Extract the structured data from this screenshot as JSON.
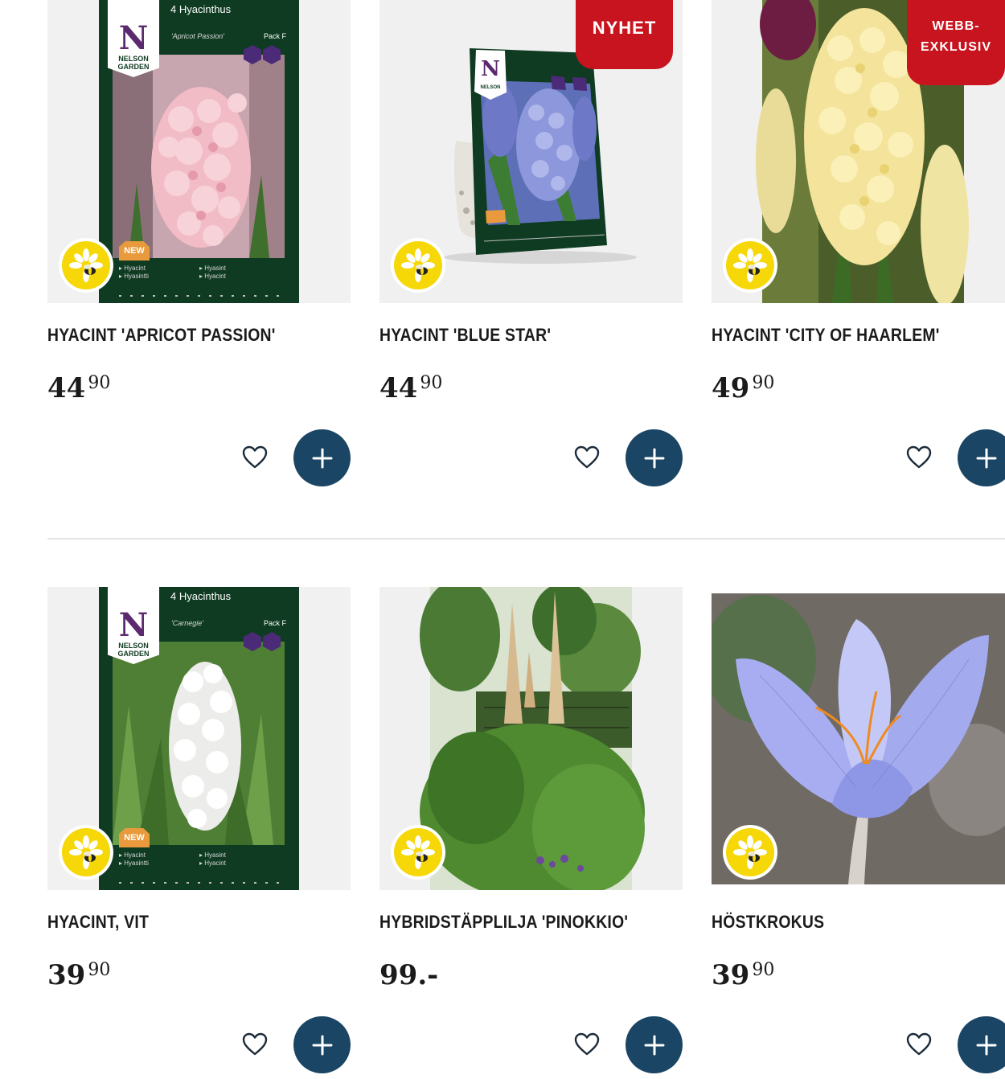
{
  "products": [
    {
      "name": "HYACINT 'APRICOT PASSION'",
      "price_main": "44",
      "price_decimal": "90",
      "image": {
        "kind": "package",
        "package_title": "4 Hyacinthus",
        "package_variety": "'Apricot Passion'",
        "zone_label": "Pack F",
        "new_label": "NEW",
        "lang_left": "Hyacint\nHyasintti",
        "lang_right": "Hyasint\nHyacint",
        "brand": "NELSON\nGARDEN",
        "flower_color": "#f2bcc6"
      }
    },
    {
      "name": "HYACINT 'BLUE STAR'",
      "price_main": "44",
      "price_decimal": "90",
      "ribbon": "NYHET",
      "image": {
        "kind": "bag-package",
        "flower_color": "#7d86d4"
      }
    },
    {
      "name": "HYACINT 'CITY OF HAARLEM'",
      "price_main": "49",
      "price_decimal": "90",
      "ribbon": "WEBB-\nEXKLUSIV",
      "image": {
        "kind": "photo",
        "flower_color": "#f4e39a"
      }
    },
    {
      "name": "HYACINT, VIT",
      "price_main": "39",
      "price_decimal": "90",
      "image": {
        "kind": "package",
        "package_title": "4 Hyacinthus",
        "package_variety": "'Carnegie'",
        "zone_label": "Pack F",
        "new_label": "NEW",
        "lang_left": "Hyacint\nHyasintti",
        "lang_right": "Hyasint\nHyacint",
        "brand": "NELSON\nGARDEN",
        "flower_color": "#f7f7f4"
      }
    },
    {
      "name": "HYBRIDSTÄPPLILJA 'PINOKKIO'",
      "price_main": "99.-",
      "price_decimal": "",
      "image": {
        "kind": "garden-photo"
      }
    },
    {
      "name": "HÖSTKROKUS",
      "price_main": "39",
      "price_decimal": "90",
      "image": {
        "kind": "crocus-photo"
      }
    }
  ],
  "icons": {
    "bee": "bee-friendly-badge-icon",
    "heart": "heart-outline-icon",
    "add": "plus-icon"
  },
  "colors": {
    "add_button": "#1a4564",
    "ribbon": "#c8141e",
    "badge_yellow": "#f6d708",
    "package_green": "#0f3b22"
  }
}
